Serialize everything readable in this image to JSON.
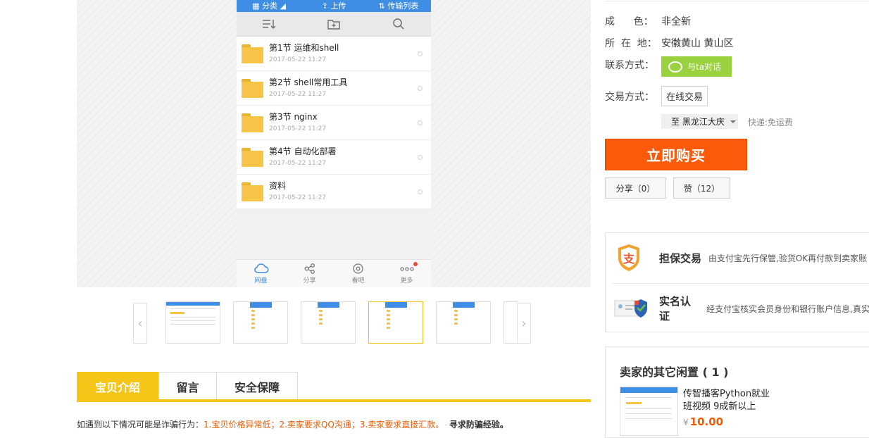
{
  "phone": {
    "top_tabs": [
      "分类",
      "上传",
      "传输列表"
    ],
    "files": [
      {
        "name": "第1节 运维和shell",
        "date": "2017-05-22  11:27"
      },
      {
        "name": "第2节 shell常用工具",
        "date": "2017-05-22  11:27"
      },
      {
        "name": "第3节 nginx",
        "date": "2017-05-22  11:27"
      },
      {
        "name": "第4节 自动化部署",
        "date": "2017-05-22  11:27"
      },
      {
        "name": "资料",
        "date": "2017-05-22  11:27"
      }
    ],
    "bottom_nav": [
      "网盘",
      "分享",
      "看吧",
      "更多"
    ]
  },
  "tabs": {
    "items": [
      "宝贝介绍",
      "留言",
      "安全保障"
    ]
  },
  "warning": {
    "prefix": "如遇到以下情况可能是诈骗行为：",
    "points": "1.宝贝价格异常低；2.卖家要求QQ沟通；3.卖家要求直接汇款。",
    "link": "寻求防骗经验。"
  },
  "product": {
    "condition_label": "成      色：",
    "condition_value": "非全新",
    "location_label": "所  在  地：",
    "location_value": "安徽黄山 黄山区",
    "contact_label": "联系方式：",
    "contact_button": "与ta对话",
    "trade_label": "交易方式：",
    "trade_value": "在线交易",
    "ship_to": "至 黑龙江大庆",
    "ship_info": "快递:免运费",
    "buy_button": "立即购买",
    "share_button": "分享（0）",
    "like_button": "赞（12）"
  },
  "guarantee": {
    "escrow_title": "担保交易",
    "escrow_desc": "由支付宝先行保管,验货OK再付款到卖家账",
    "realname_title": "实名认证",
    "realname_desc": "经支付宝核实会员身份和银行账户信息,真实"
  },
  "seller": {
    "title": "卖家的其它闲置 ( 1 )",
    "item_title": "传智播客Python就业班视频 9成新以上",
    "currency": "¥",
    "item_price": "10.00"
  },
  "colors": {
    "accent_yellow": "#f5c518",
    "buy_orange": "#fb5a0a",
    "wechat_green": "#9ad13e",
    "phone_blue": "#3d8ee4"
  }
}
